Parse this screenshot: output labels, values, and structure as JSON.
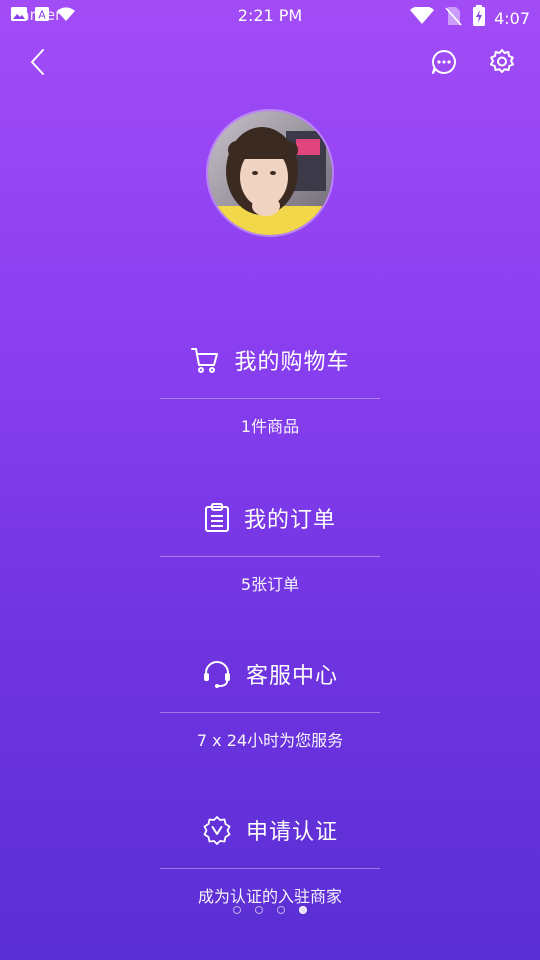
{
  "status_bar": {
    "carrier": "Carrier",
    "time": "2:21 PM",
    "battery": "4:07"
  },
  "menu": [
    {
      "title": "我的购物车",
      "subtitle": "1件商品",
      "icon": "cart-icon"
    },
    {
      "title": "我的订单",
      "subtitle": "5张订单",
      "icon": "order-list-icon"
    },
    {
      "title": "客服中心",
      "subtitle": "7 x 24小时为您服务",
      "icon": "headset-icon"
    },
    {
      "title": "申请认证",
      "subtitle": "成为认证的入驻商家",
      "icon": "verified-badge-icon"
    }
  ],
  "pager": {
    "total": 4,
    "active": 4
  },
  "colors": {
    "gradient_top": "#a24cf6",
    "gradient_bottom": "#5a2fd3"
  }
}
